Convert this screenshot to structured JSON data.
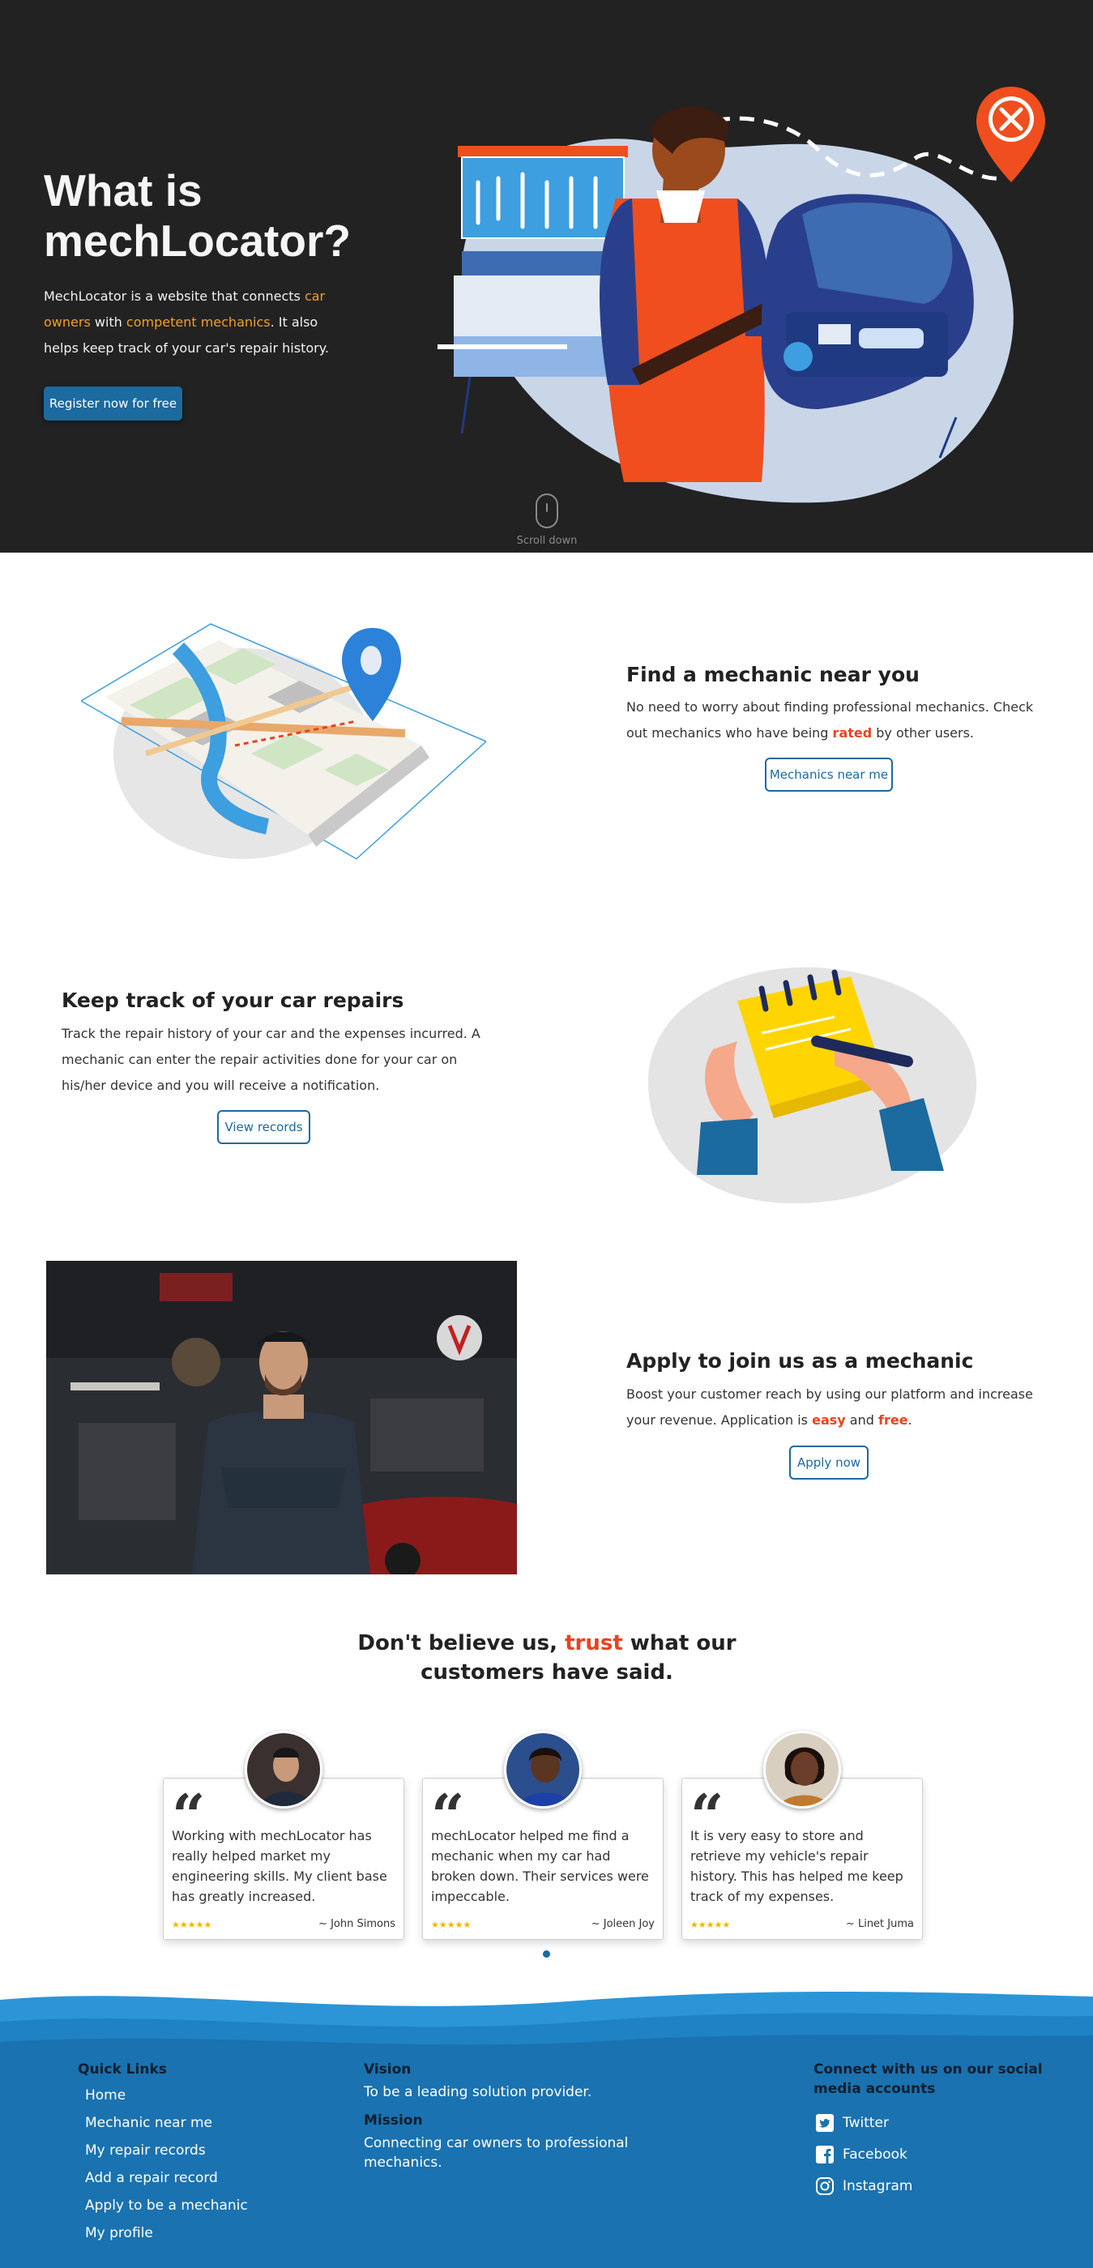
{
  "hero": {
    "title": "What is mechLocator?",
    "desc_part1": "MechLocator is a website that connects ",
    "desc_hl1": "car owners",
    "desc_part2": " with ",
    "desc_hl2": "competent mechanics",
    "desc_part3": ". It also helps keep track of your car's repair history.",
    "cta_label": "Register now for free",
    "scroll_label": "Scroll down"
  },
  "find": {
    "title": "Find a mechanic near you",
    "text_part1": "No need to worry about finding professional mechanics. Check out mechanics who have being ",
    "text_red": "rated",
    "text_part2": " by other users.",
    "button_label": "Mechanics near me"
  },
  "track": {
    "title": "Keep track of your car repairs",
    "text": "Track the repair history of your car and the expenses incurred. A mechanic can enter the repair activities done for your car on his/her device and you will receive a notification.",
    "button_label": "View records"
  },
  "apply": {
    "title": "Apply to join us as a mechanic",
    "text_part1": "Boost your customer reach by using our platform and increase your revenue. Application is ",
    "text_red1": "easy",
    "text_part2": " and ",
    "text_red2": "free",
    "text_part3": ".",
    "button_label": "Apply now"
  },
  "testimonials": {
    "heading_part1": "Don't believe us, ",
    "heading_trust": "trust",
    "heading_part2": " what our customers have said.",
    "quote_mark": "“",
    "items": [
      {
        "text": "Working with mechLocator has really helped market my engineering skills. My client base has greatly increased.",
        "stars": "★★★★★",
        "author": "~ John Simons"
      },
      {
        "text": "mechLocator helped me find a mechanic when my car had broken down. Their services were impeccable.",
        "stars": "★★★★★",
        "author": "~ Joleen Joy"
      },
      {
        "text": "It is very easy to store and retrieve my vehicle's repair history. This has helped me keep track of my expenses.",
        "stars": "★★★★★",
        "author": "~ Linet Juma"
      }
    ]
  },
  "footer": {
    "quick_links_title": "Quick Links",
    "links": [
      "Home",
      "Mechanic near me",
      "My repair records",
      "Add a repair record",
      "Apply to be a mechanic",
      "My profile"
    ],
    "vision_title": "Vision",
    "vision_text": "To be a leading solution provider.",
    "mission_title": "Mission",
    "mission_text": "Connecting car owners to professional mechanics.",
    "social_title": "Connect with us on our social media accounts",
    "social": [
      {
        "label": "Twitter",
        "icon": "twitter-icon"
      },
      {
        "label": "Facebook",
        "icon": "facebook-icon"
      },
      {
        "label": "Instagram",
        "icon": "instagram-icon"
      }
    ]
  },
  "colors": {
    "hero_bg": "#222222",
    "accent_blue": "#1b6aa0",
    "accent_orange": "#f0a028",
    "accent_red": "#e8431e",
    "footer_blue": "#1a72b0"
  }
}
